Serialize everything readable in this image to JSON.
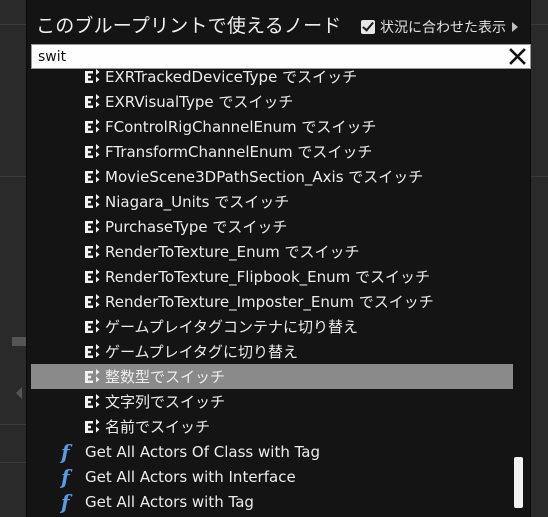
{
  "header": {
    "title": "このブループリントで使えるノード",
    "context_label": "状況に合わせた表示"
  },
  "search": {
    "value": "swit"
  },
  "switch_items": [
    {
      "label": "EXRTrackedDeviceType でスイッチ"
    },
    {
      "label": "EXRVisualType でスイッチ"
    },
    {
      "label": "FControlRigChannelEnum でスイッチ"
    },
    {
      "label": "FTransformChannelEnum でスイッチ"
    },
    {
      "label": "MovieScene3DPathSection_Axis でスイッチ"
    },
    {
      "label": "Niagara_Units でスイッチ"
    },
    {
      "label": "PurchaseType でスイッチ"
    },
    {
      "label": "RenderToTexture_Enum でスイッチ"
    },
    {
      "label": "RenderToTexture_Flipbook_Enum でスイッチ"
    },
    {
      "label": "RenderToTexture_Imposter_Enum でスイッチ"
    },
    {
      "label": "ゲームプレイタグコンテナに切り替え"
    },
    {
      "label": "ゲームプレイタグに切り替え"
    },
    {
      "label": "整数型でスイッチ",
      "selected": true
    },
    {
      "label": "文字列でスイッチ"
    },
    {
      "label": "名前でスイッチ"
    }
  ],
  "function_items": [
    {
      "label": "Get All Actors Of Class with Tag"
    },
    {
      "label": "Get All Actors with Interface"
    },
    {
      "label": "Get All Actors with Tag"
    }
  ],
  "colors": {
    "function_icon": "#5b9be6",
    "selected_row": "#8a8a8a"
  },
  "icons": {
    "switch": "switch-node-icon",
    "function": "function-icon"
  }
}
